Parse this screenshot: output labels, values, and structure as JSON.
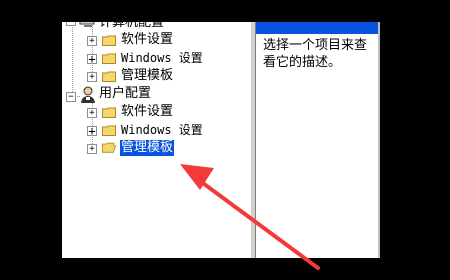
{
  "tree": {
    "computer_config": {
      "label": "计算机配置",
      "children": [
        "软件设置",
        "Windows 设置",
        "管理模板"
      ]
    },
    "user_config": {
      "label": "用户配置",
      "children": [
        "软件设置",
        "Windows 设置",
        "管理模板"
      ]
    },
    "expander_symbol": "+",
    "collapse_symbol": "−"
  },
  "detail": {
    "text": "选择一个项目来查看它的描述。"
  },
  "colors": {
    "selection": "#0a52e0",
    "arrow": "#f23a3a",
    "folder": "#f5d76e"
  },
  "icons": {
    "folder": "folder-icon",
    "computer": "computer-icon",
    "user": "user-icon",
    "annotation": "red-arrow-annotation"
  }
}
